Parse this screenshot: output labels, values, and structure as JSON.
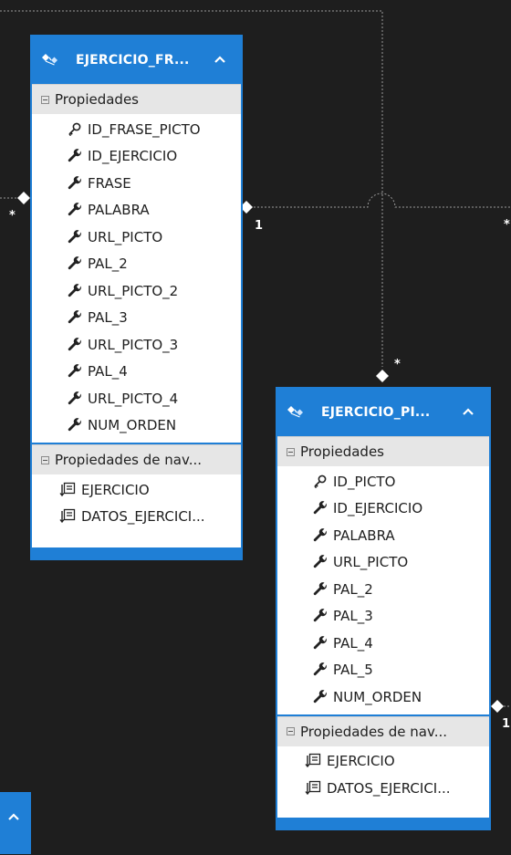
{
  "connector": {
    "cardinality_many": "*",
    "cardinality_one": "1"
  },
  "entity_frase": {
    "title": "EJERCICIO_FR...",
    "properties_label": "Propiedades",
    "properties": [
      {
        "name": "ID_FRASE_PICTO",
        "icon": "key-icon"
      },
      {
        "name": "ID_EJERCICIO",
        "icon": "wrench-icon"
      },
      {
        "name": "FRASE",
        "icon": "wrench-icon"
      },
      {
        "name": "PALABRA",
        "icon": "wrench-icon"
      },
      {
        "name": "URL_PICTO",
        "icon": "wrench-icon"
      },
      {
        "name": "PAL_2",
        "icon": "wrench-icon"
      },
      {
        "name": "URL_PICTO_2",
        "icon": "wrench-icon"
      },
      {
        "name": "PAL_3",
        "icon": "wrench-icon"
      },
      {
        "name": "URL_PICTO_3",
        "icon": "wrench-icon"
      },
      {
        "name": "PAL_4",
        "icon": "wrench-icon"
      },
      {
        "name": "URL_PICTO_4",
        "icon": "wrench-icon"
      },
      {
        "name": "NUM_ORDEN",
        "icon": "wrench-icon"
      }
    ],
    "nav_label": "Propiedades de nav...",
    "nav_properties": [
      {
        "name": "EJERCICIO",
        "icon": "navigation-property-icon"
      },
      {
        "name": "DATOS_EJERCICI...",
        "icon": "navigation-property-icon"
      }
    ]
  },
  "entity_picto": {
    "title": "EJERCICIO_PI...",
    "properties_label": "Propiedades",
    "properties": [
      {
        "name": "ID_PICTO",
        "icon": "key-icon"
      },
      {
        "name": "ID_EJERCICIO",
        "icon": "wrench-icon"
      },
      {
        "name": "PALABRA",
        "icon": "wrench-icon"
      },
      {
        "name": "URL_PICTO",
        "icon": "wrench-icon"
      },
      {
        "name": "PAL_2",
        "icon": "wrench-icon"
      },
      {
        "name": "PAL_3",
        "icon": "wrench-icon"
      },
      {
        "name": "PAL_4",
        "icon": "wrench-icon"
      },
      {
        "name": "PAL_5",
        "icon": "wrench-icon"
      },
      {
        "name": "NUM_ORDEN",
        "icon": "wrench-icon"
      }
    ],
    "nav_label": "Propiedades de nav...",
    "nav_properties": [
      {
        "name": "EJERCICIO",
        "icon": "navigation-property-icon"
      },
      {
        "name": "DATOS_EJERCICI...",
        "icon": "navigation-property-icon"
      }
    ]
  },
  "colors": {
    "canvas": "#1e1e1e",
    "accent": "#1f7fd6",
    "line": "#9a9a9a"
  }
}
